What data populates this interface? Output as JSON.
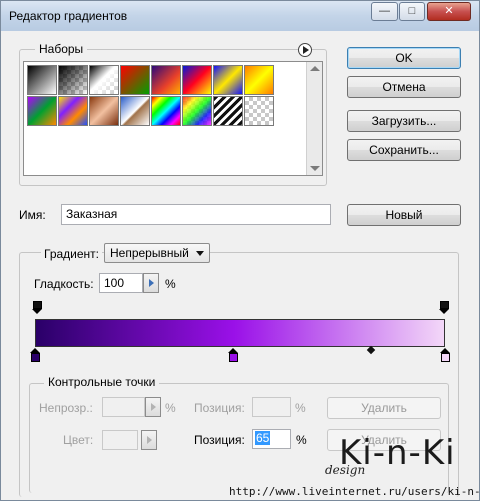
{
  "window": {
    "title": "Редактор градиентов",
    "controls": {
      "minimize": "—",
      "maximize": "□",
      "close": "✕"
    }
  },
  "presets": {
    "label": "Наборы",
    "menu_icon": "play-circle-icon",
    "swatches": [
      {
        "kind": "black-white"
      },
      {
        "kind": "black-transparent"
      },
      {
        "kind": "white-transparent"
      },
      {
        "kind": "red-green"
      },
      {
        "kind": "violet-orange"
      },
      {
        "kind": "blue-red-yellow"
      },
      {
        "kind": "blue-yellow-blue"
      },
      {
        "kind": "orange-yellow-orange"
      },
      {
        "kind": "violet-green-orange"
      },
      {
        "kind": "yellow-violet-orange-blue"
      },
      {
        "kind": "copper"
      },
      {
        "kind": "chrome"
      },
      {
        "kind": "spectrum"
      },
      {
        "kind": "transparent-rainbow"
      },
      {
        "kind": "transparent-stripes"
      },
      {
        "kind": "transparent"
      }
    ]
  },
  "buttons": {
    "ok": "OK",
    "cancel": "Отмена",
    "load": "Загрузить...",
    "save": "Сохранить...",
    "new": "Новый"
  },
  "name": {
    "label": "Имя:",
    "value": "Заказная"
  },
  "gradient": {
    "type_label": "Градиент:",
    "type_value": "Непрерывный",
    "smooth_label": "Гладкость:",
    "smooth_value": "100",
    "smooth_unit": "%",
    "colors": {
      "start": "#2a0068",
      "mid": "#9a10e8",
      "end": "#f3c4f7"
    },
    "stops": {
      "color_stops": [
        {
          "location": 0,
          "color": "#2a0068"
        },
        {
          "location": 0.485,
          "color": "#9a10e8"
        },
        {
          "location": 1,
          "color": "#f3d7f8"
        }
      ],
      "opacity_stops": [
        0,
        1
      ],
      "selected_midpoint": 0.82
    }
  },
  "control_points": {
    "label": "Контрольные точки",
    "opacity_label": "Непрозр.:",
    "opacity_unit": "%",
    "opacity_position_label": "Позиция:",
    "opacity_position_unit": "%",
    "opacity_delete": "Удалить",
    "color_label": "Цвет:",
    "color_position_label": "Позиция:",
    "color_position_value": "65",
    "color_position_unit": "%",
    "color_delete": "Удалить"
  },
  "watermark": {
    "logo": "Ki-n-Ki",
    "design": "design",
    "url": "http://www.liveinternet.ru/users/ki-n-ki/"
  }
}
